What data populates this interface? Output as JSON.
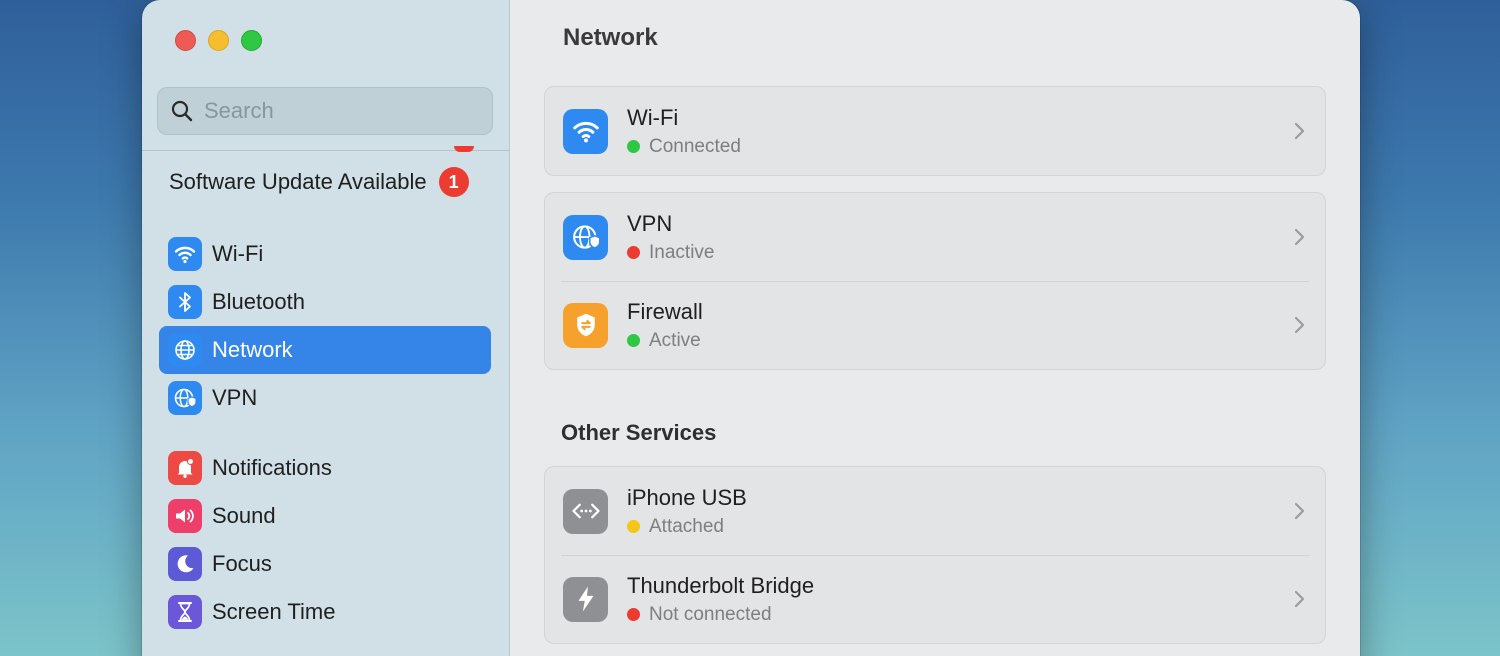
{
  "sidebar": {
    "search_placeholder": "Search",
    "update_label": "Software Update Available",
    "update_badge": "1",
    "items": [
      {
        "label": "Wi-Fi",
        "icon": "wifi-icon",
        "color": "#2e8af1"
      },
      {
        "label": "Bluetooth",
        "icon": "bluetooth-icon",
        "color": "#2e8af1"
      },
      {
        "label": "Network",
        "icon": "globe-icon",
        "color": "#2e8af1",
        "active": true
      },
      {
        "label": "VPN",
        "icon": "vpn-globe-icon",
        "color": "#2e8af1"
      },
      {
        "label": "Notifications",
        "icon": "bell-icon",
        "color": "#ee4a45"
      },
      {
        "label": "Sound",
        "icon": "speaker-icon",
        "color": "#ee3f6a"
      },
      {
        "label": "Focus",
        "icon": "moon-icon",
        "color": "#5d5ad6"
      },
      {
        "label": "Screen Time",
        "icon": "hourglass-icon",
        "color": "#6b58d8"
      }
    ]
  },
  "main": {
    "title": "Network",
    "services": [
      {
        "title": "Wi-Fi",
        "status": "Connected",
        "status_color": "#2fc843",
        "icon": "wifi-icon"
      },
      {
        "title": "VPN",
        "status": "Inactive",
        "status_color": "#ec3b30",
        "icon": "vpn-globe-icon"
      },
      {
        "title": "Firewall",
        "status": "Active",
        "status_color": "#2fc843",
        "icon": "firewall-icon"
      }
    ],
    "other_title": "Other Services",
    "other_services": [
      {
        "title": "iPhone USB",
        "status": "Attached",
        "status_color": "#f5c518",
        "icon": "usb-icon"
      },
      {
        "title": "Thunderbolt Bridge",
        "status": "Not connected",
        "status_color": "#ec3b30",
        "icon": "thunderbolt-icon"
      }
    ]
  }
}
